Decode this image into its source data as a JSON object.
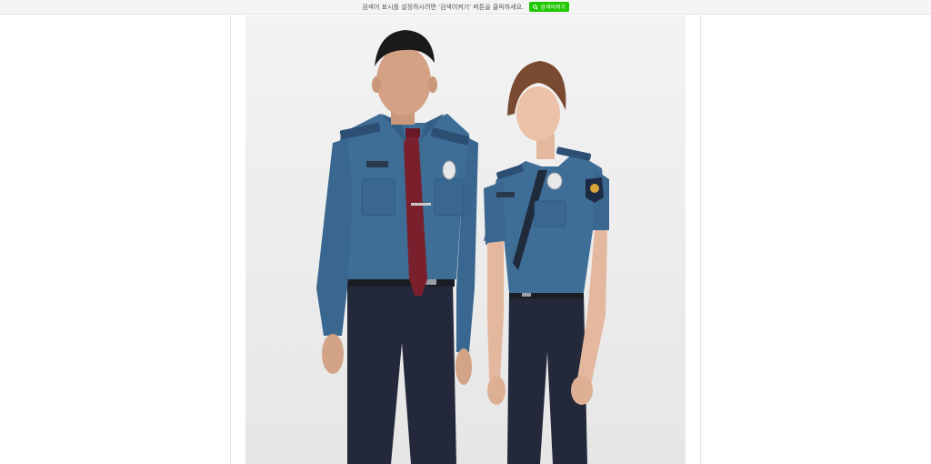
{
  "notice_bar": {
    "message": "검색어 표시를 설정하시려면 '검색어켜기' 버튼을 클릭하세요.",
    "button_label": "검색어켜기",
    "button_icon": "search-icon",
    "button_color": "#1ec800"
  },
  "photo": {
    "subject": "police-uniforms-photo",
    "uniform_shirt_color": "#3e6d96",
    "uniform_pants_color": "#24283a",
    "tie_color": "#7a1f2c"
  }
}
